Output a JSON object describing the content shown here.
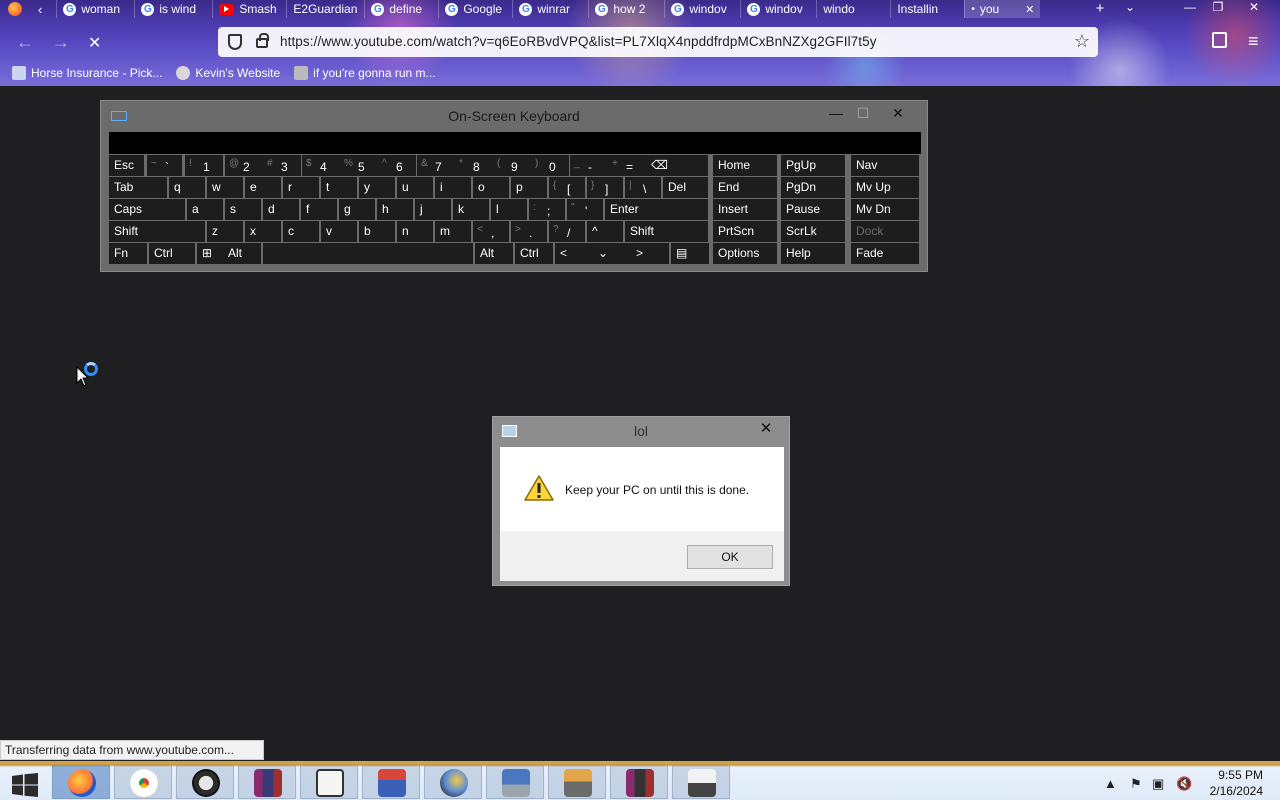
{
  "browser": {
    "tabs": [
      {
        "label": "woman",
        "icon": "google"
      },
      {
        "label": "is wind",
        "icon": "google"
      },
      {
        "label": "Smash",
        "icon": "youtube"
      },
      {
        "label": "E2Guardian",
        "icon": "none"
      },
      {
        "label": "define",
        "icon": "google"
      },
      {
        "label": "Google",
        "icon": "google"
      },
      {
        "label": "winrar",
        "icon": "google"
      },
      {
        "label": "how 2",
        "icon": "google"
      },
      {
        "label": "windov",
        "icon": "google"
      },
      {
        "label": "windov",
        "icon": "google"
      },
      {
        "label": "windo",
        "icon": "none"
      },
      {
        "label": "Installin",
        "icon": "none"
      },
      {
        "label": "you",
        "icon": "dot"
      }
    ],
    "new_tab": "+",
    "tab_list": "⌄",
    "window_controls": {
      "minimize": "—",
      "maximize": "❐",
      "close": "✕"
    },
    "back": "←",
    "forward": "→",
    "stop": "✕",
    "url": "https://www.youtube.com/watch?v=q6EoRBvdVPQ&list=PL7XlqX4npddfrdpMCxBnNZXg2GFIl7t5y",
    "bookmarks": [
      "Horse Insurance - Pick...",
      "Kevin's Website",
      "if you're gonna run m..."
    ],
    "status_text": "Transferring data from www.youtube.com..."
  },
  "osk": {
    "title": "On-Screen Keyboard",
    "controls": {
      "minimize": "—",
      "maximize": "☐",
      "close": "✕"
    },
    "rows": [
      [
        {
          "l": "Esc"
        },
        {
          "s": "~",
          "m": "`"
        },
        {
          "s": "!",
          "m": "1"
        },
        {
          "s": "@",
          "m": "2"
        },
        {
          "s": "#",
          "m": "3"
        },
        {
          "s": "$",
          "m": "4"
        },
        {
          "s": "%",
          "m": "5"
        },
        {
          "s": "^",
          "m": "6"
        },
        {
          "s": "&",
          "m": "7"
        },
        {
          "s": "*",
          "m": "8"
        },
        {
          "s": "(",
          "m": "9"
        },
        {
          "s": ")",
          "m": "0"
        },
        {
          "s": "_",
          "m": "-"
        },
        {
          "s": "+",
          "m": "="
        },
        {
          "l": "⌫"
        }
      ],
      [
        {
          "l": "Tab"
        },
        {
          "l": "q"
        },
        {
          "l": "w"
        },
        {
          "l": "e"
        },
        {
          "l": "r"
        },
        {
          "l": "t"
        },
        {
          "l": "y"
        },
        {
          "l": "u"
        },
        {
          "l": "i"
        },
        {
          "l": "o"
        },
        {
          "l": "p"
        },
        {
          "s": "{",
          "m": "["
        },
        {
          "s": "}",
          "m": "]"
        },
        {
          "s": "|",
          "m": "\\"
        },
        {
          "l": "Del"
        }
      ],
      [
        {
          "l": "Caps"
        },
        {
          "l": "a"
        },
        {
          "l": "s"
        },
        {
          "l": "d"
        },
        {
          "l": "f"
        },
        {
          "l": "g"
        },
        {
          "l": "h"
        },
        {
          "l": "j"
        },
        {
          "l": "k"
        },
        {
          "l": "l"
        },
        {
          "s": ":",
          "m": ";"
        },
        {
          "s": "\"",
          "m": "'"
        },
        {
          "l": "Enter"
        }
      ],
      [
        {
          "l": "Shift"
        },
        {
          "l": "z"
        },
        {
          "l": "x"
        },
        {
          "l": "c"
        },
        {
          "l": "v"
        },
        {
          "l": "b"
        },
        {
          "l": "n"
        },
        {
          "l": "m"
        },
        {
          "s": "<",
          "m": ","
        },
        {
          "s": ">",
          "m": "."
        },
        {
          "s": "?",
          "m": "/"
        },
        {
          "l": "^"
        },
        {
          "l": "Shift"
        }
      ],
      [
        {
          "l": "Fn"
        },
        {
          "l": "Ctrl"
        },
        {
          "l": "⊞"
        },
        {
          "l": "Alt"
        },
        {
          "l": ""
        },
        {
          "l": "Alt"
        },
        {
          "l": "Ctrl"
        },
        {
          "l": "<"
        },
        {
          "l": "⌄"
        },
        {
          "l": ">"
        },
        {
          "l": "▤"
        }
      ]
    ],
    "nav_rows": [
      [
        "Home",
        "PgUp",
        "Nav"
      ],
      [
        "End",
        "PgDn",
        "Mv Up"
      ],
      [
        "Insert",
        "Pause",
        "Mv Dn"
      ],
      [
        "PrtScn",
        "ScrLk",
        "Dock"
      ],
      [
        "Options",
        "Help",
        "Fade"
      ]
    ]
  },
  "dialog": {
    "title": "lol",
    "close": "✕",
    "message": "Keep your PC on until this is done.",
    "ok_label": "OK"
  },
  "taskbar": {
    "apps": [
      "firefox",
      "chrome",
      "clock",
      "winrar",
      "cmd",
      "paint",
      "brush",
      "scanner",
      "keyboard",
      "winrar-2",
      "tools"
    ],
    "time": "9:55 PM",
    "date": "2/16/2024"
  }
}
